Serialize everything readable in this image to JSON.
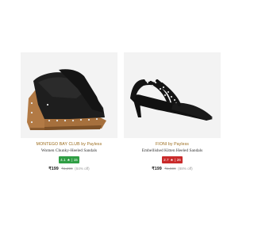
{
  "products": [
    {
      "brand": "MONTEGO BAY CLUB by Payless",
      "title": "Women Chunky-Heeled Sandals",
      "rating": {
        "value": "4.1",
        "star": "★",
        "separator": "|",
        "count": "15",
        "color": "#2f9e44"
      },
      "price": "₹199",
      "mrp": "₹1,299",
      "discount": "(84% off)",
      "image_icon": "black-chunky-heel-mule-sandal"
    },
    {
      "brand": "FIONI by Payless",
      "title": "Embellished Kitten Heeled Sandals",
      "rating": {
        "value": "2.7",
        "star": "★",
        "separator": "|",
        "count": "26",
        "color": "#c92a2a"
      },
      "price": "₹199",
      "mrp": "₹1,599",
      "discount": "(88% off)",
      "image_icon": "black-strappy-kitten-heel-sandal"
    }
  ]
}
